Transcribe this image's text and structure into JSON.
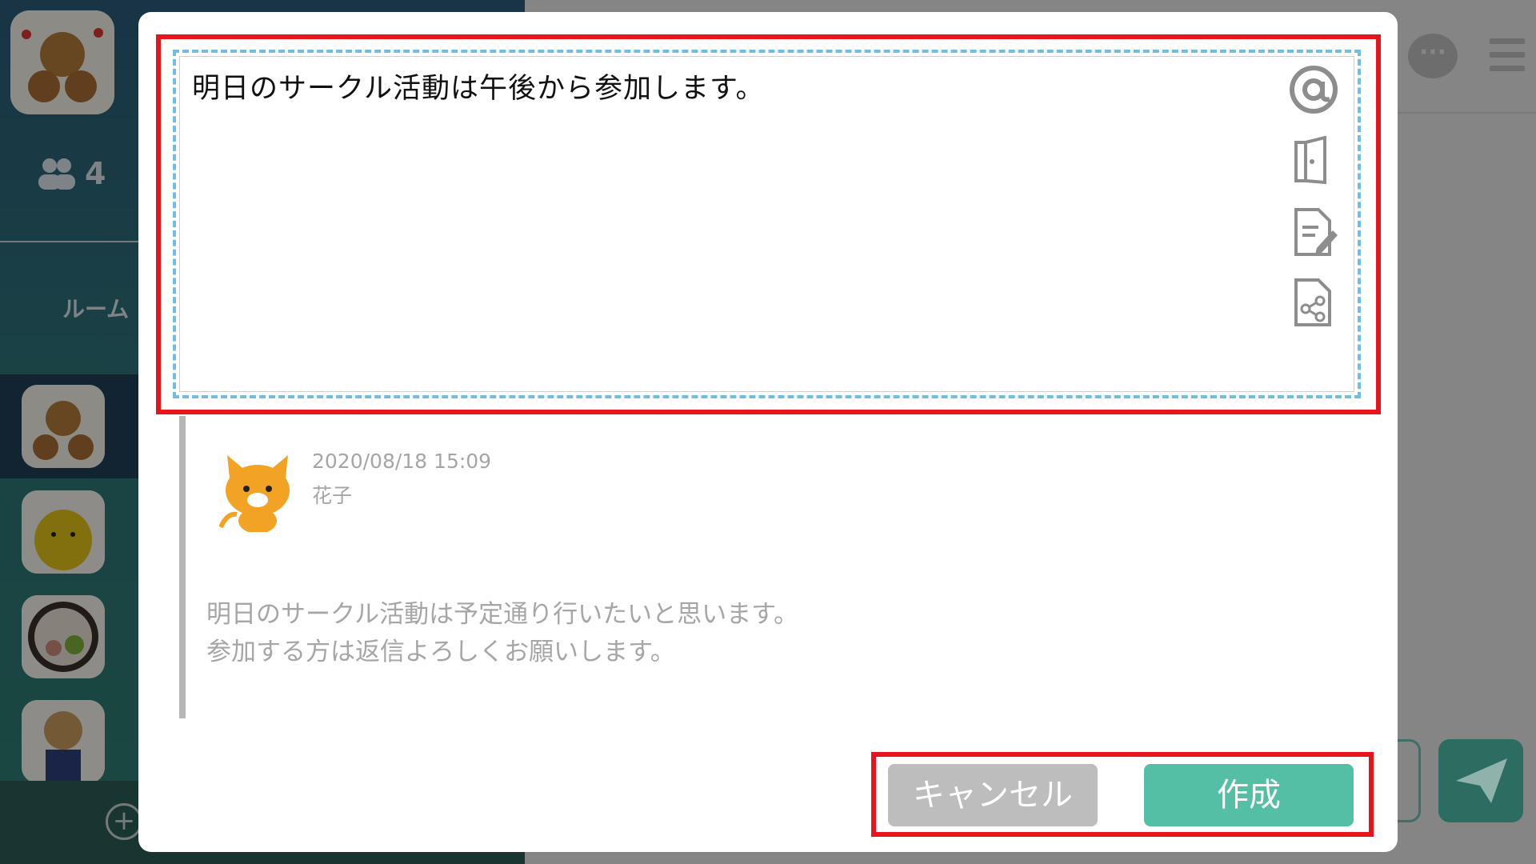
{
  "sidebar": {
    "member_count": "4",
    "room_heading": "ルーム",
    "add_icon": "plus-circle-icon"
  },
  "compose": {
    "text": "明日のサークル活動は午後から参加します。",
    "tools": [
      "mention-icon",
      "door-icon",
      "note-edit-icon",
      "file-share-icon"
    ]
  },
  "quoted_post": {
    "timestamp": "2020/08/18 15:09",
    "author": "花子",
    "body_line1": "明日のサークル活動は予定通り行いたいと思います。",
    "body_line2": "参加する方は返信よろしくお願いします。"
  },
  "buttons": {
    "cancel_label": "キャンセル",
    "create_label": "作成"
  },
  "colors": {
    "highlight": "#e8141c",
    "create": "#55bfa5",
    "cancel": "#bdbdbd",
    "dashed": "#72bde8"
  }
}
